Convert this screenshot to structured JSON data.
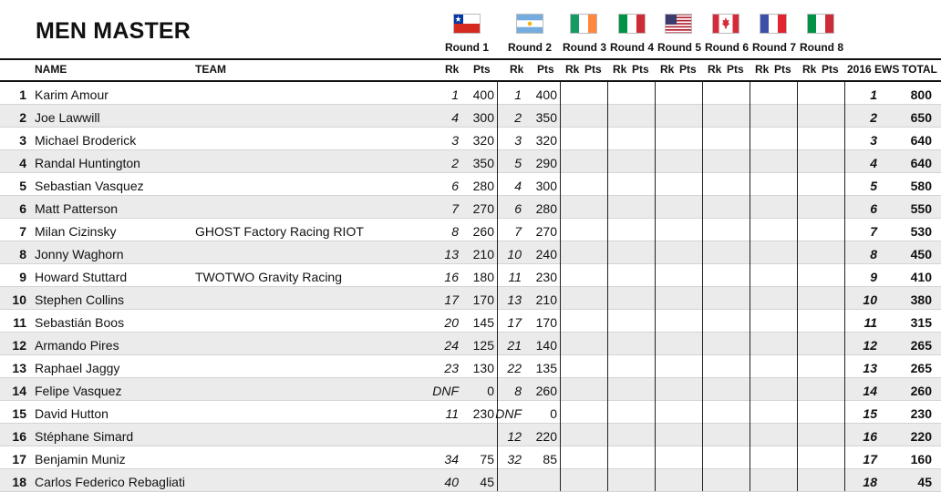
{
  "title": "MEN MASTER",
  "rounds": [
    {
      "label": "Round 1",
      "flag": "chile-flag"
    },
    {
      "label": "Round 2",
      "flag": "argentina-flag"
    },
    {
      "label": "Round 3",
      "flag": "ireland-flag"
    },
    {
      "label": "Round 4",
      "flag": "italy-flag"
    },
    {
      "label": "Round 5",
      "flag": "usa-flag"
    },
    {
      "label": "Round 6",
      "flag": "canada-flag"
    },
    {
      "label": "Round 7",
      "flag": "france-flag"
    },
    {
      "label": "Round 8",
      "flag": "italy-flag"
    }
  ],
  "headers": {
    "name": "NAME",
    "team": "TEAM",
    "rk": "Rk",
    "pts": "Pts",
    "ews": "2016 EWS",
    "total": "TOTAL"
  },
  "rows": [
    {
      "pos": "1",
      "name": "Karim Amour",
      "team": "",
      "r1rk": "1",
      "r1pts": "400",
      "r2rk": "1",
      "r2pts": "400",
      "ews": "1",
      "total": "800"
    },
    {
      "pos": "2",
      "name": "Joe Lawwill",
      "team": "",
      "r1rk": "4",
      "r1pts": "300",
      "r2rk": "2",
      "r2pts": "350",
      "ews": "2",
      "total": "650"
    },
    {
      "pos": "3",
      "name": "Michael Broderick",
      "team": "",
      "r1rk": "3",
      "r1pts": "320",
      "r2rk": "3",
      "r2pts": "320",
      "ews": "3",
      "total": "640"
    },
    {
      "pos": "4",
      "name": "Randal Huntington",
      "team": "",
      "r1rk": "2",
      "r1pts": "350",
      "r2rk": "5",
      "r2pts": "290",
      "ews": "4",
      "total": "640"
    },
    {
      "pos": "5",
      "name": "Sebastian Vasquez",
      "team": "",
      "r1rk": "6",
      "r1pts": "280",
      "r2rk": "4",
      "r2pts": "300",
      "ews": "5",
      "total": "580"
    },
    {
      "pos": "6",
      "name": "Matt Patterson",
      "team": "",
      "r1rk": "7",
      "r1pts": "270",
      "r2rk": "6",
      "r2pts": "280",
      "ews": "6",
      "total": "550"
    },
    {
      "pos": "7",
      "name": "Milan Cizinsky",
      "team": "GHOST Factory Racing RIOT",
      "r1rk": "8",
      "r1pts": "260",
      "r2rk": "7",
      "r2pts": "270",
      "ews": "7",
      "total": "530"
    },
    {
      "pos": "8",
      "name": "Jonny Waghorn",
      "team": "",
      "r1rk": "13",
      "r1pts": "210",
      "r2rk": "10",
      "r2pts": "240",
      "ews": "8",
      "total": "450"
    },
    {
      "pos": "9",
      "name": "Howard Stuttard",
      "team": "TWOTWO Gravity Racing",
      "r1rk": "16",
      "r1pts": "180",
      "r2rk": "11",
      "r2pts": "230",
      "ews": "9",
      "total": "410"
    },
    {
      "pos": "10",
      "name": "Stephen Collins",
      "team": "",
      "r1rk": "17",
      "r1pts": "170",
      "r2rk": "13",
      "r2pts": "210",
      "ews": "10",
      "total": "380"
    },
    {
      "pos": "11",
      "name": "Sebastián Boos",
      "team": "",
      "r1rk": "20",
      "r1pts": "145",
      "r2rk": "17",
      "r2pts": "170",
      "ews": "11",
      "total": "315"
    },
    {
      "pos": "12",
      "name": "Armando Pires",
      "team": "",
      "r1rk": "24",
      "r1pts": "125",
      "r2rk": "21",
      "r2pts": "140",
      "ews": "12",
      "total": "265"
    },
    {
      "pos": "13",
      "name": "Raphael Jaggy",
      "team": "",
      "r1rk": "23",
      "r1pts": "130",
      "r2rk": "22",
      "r2pts": "135",
      "ews": "13",
      "total": "265"
    },
    {
      "pos": "14",
      "name": "Felipe Vasquez",
      "team": "",
      "r1rk": "DNF",
      "r1pts": "0",
      "r2rk": "8",
      "r2pts": "260",
      "ews": "14",
      "total": "260"
    },
    {
      "pos": "15",
      "name": "David Hutton",
      "team": "",
      "r1rk": "11",
      "r1pts": "230",
      "r2rk": "DNF",
      "r2pts": "0",
      "ews": "15",
      "total": "230"
    },
    {
      "pos": "16",
      "name": "Stéphane Simard",
      "team": "",
      "r1rk": "",
      "r1pts": "",
      "r2rk": "12",
      "r2pts": "220",
      "ews": "16",
      "total": "220"
    },
    {
      "pos": "17",
      "name": "Benjamin Muniz",
      "team": "",
      "r1rk": "34",
      "r1pts": "75",
      "r2rk": "32",
      "r2pts": "85",
      "ews": "17",
      "total": "160"
    },
    {
      "pos": "18",
      "name": "Carlos Federico Rebagliati",
      "team": "",
      "r1rk": "40",
      "r1pts": "45",
      "r2rk": "",
      "r2pts": "",
      "ews": "18",
      "total": "45"
    }
  ]
}
